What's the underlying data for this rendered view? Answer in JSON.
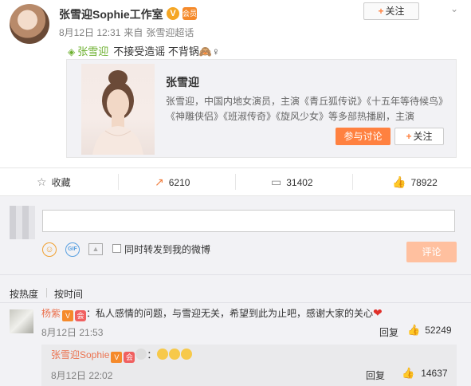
{
  "post": {
    "author": "张雪迎Sophie工作室",
    "verified_icon": "V",
    "vip_icon": "会员",
    "follow_label": "关注",
    "date": "8月12日 12:31",
    "source_prefix": "来自",
    "source": "张雪迎超话",
    "mention": "张雪迎",
    "text": "不接受造谣 不背锅🙈♀"
  },
  "card": {
    "title": "张雪迎",
    "description": "张雪迎，中国内地女演员，主演《青丘狐传说》《十五年等待候鸟》《神雕侠侣》《班淑传奇》《旋风少女》等多部热播剧，主演",
    "discuss_label": "参与讨论",
    "follow_label": "关注"
  },
  "actions": {
    "favorite_label": "收藏",
    "repost_count": "6210",
    "comment_count": "31402",
    "like_count": "78922"
  },
  "composer": {
    "placeholder": "",
    "sync_label": "同时转发到我的微博",
    "submit_label": "评论"
  },
  "sort": {
    "hot_label": "按热度",
    "time_label": "按时间"
  },
  "comments": [
    {
      "user": "杨紫",
      "text": "：私人感情的问题，与雪迎无关，希望到此为止吧，感谢大家的关心",
      "time": "8月12日 21:53",
      "reply_label": "回复",
      "likes": "52249"
    }
  ],
  "reply": {
    "user": "张雪迎Sophie",
    "text": "：",
    "time": "8月12日 22:02",
    "reply_label": "回复",
    "likes": "14637"
  },
  "colors": {
    "accent": "#ff8140",
    "link": "#eb7350",
    "green": "#6cb02e"
  }
}
